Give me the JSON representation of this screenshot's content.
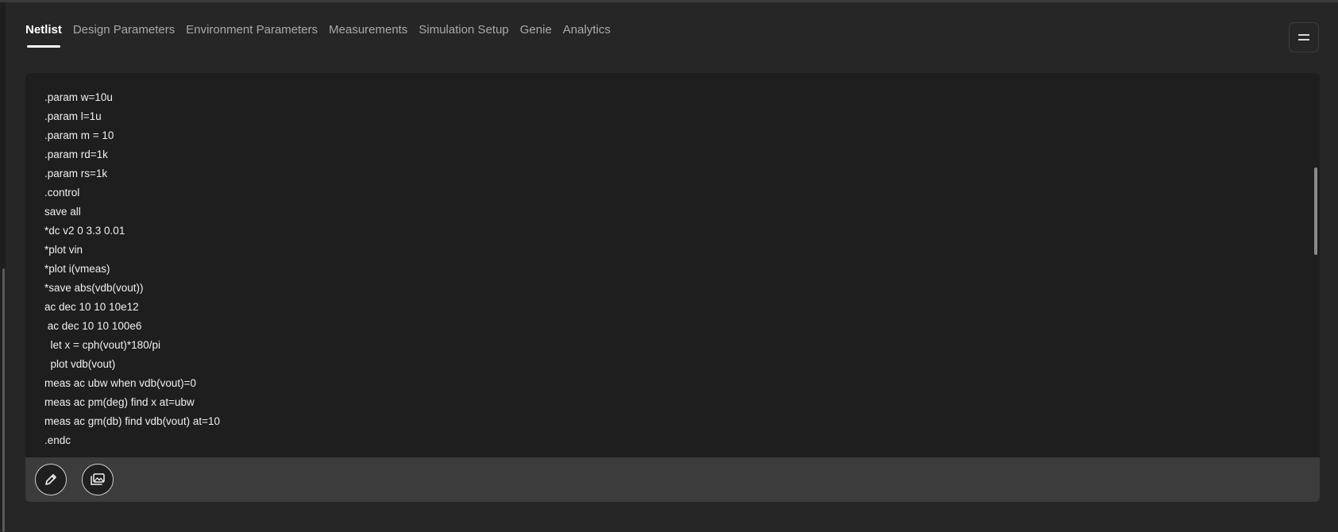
{
  "tabs": [
    {
      "label": "Netlist",
      "active": true
    },
    {
      "label": "Design Parameters",
      "active": false
    },
    {
      "label": "Environment Parameters",
      "active": false
    },
    {
      "label": "Measurements",
      "active": false
    },
    {
      "label": "Simulation Setup",
      "active": false
    },
    {
      "label": "Genie",
      "active": false
    },
    {
      "label": "Analytics",
      "active": false
    }
  ],
  "header": {
    "menu_icon": "menu-icon"
  },
  "editor": {
    "lines": [
      ".param w=10u",
      ".param l=1u",
      ".param m = 10",
      ".param rd=1k",
      ".param rs=1k",
      ".control",
      "save all",
      "*dc v2 0 3.3 0.01",
      "*plot vin",
      "*plot i(vmeas)",
      "*save abs(vdb(vout))",
      "ac dec 10 10 10e12",
      " ac dec 10 10 100e6",
      "  let x = cph(vout)*180/pi",
      "  plot vdb(vout)",
      "meas ac ubw when vdb(vout)=0",
      "meas ac pm(deg) find x at=ubw",
      "meas ac gm(db) find vdb(vout) at=10",
      ".endc"
    ]
  },
  "toolbar": {
    "edit_icon": "pencil-icon",
    "image_icon": "images-icon"
  },
  "colors": {
    "background": "#262626",
    "editor_background": "#1e1e1e",
    "toolbar_background": "#3c3c3c",
    "active_tab": "#ffffff",
    "inactive_tab": "#a9a9a9"
  }
}
